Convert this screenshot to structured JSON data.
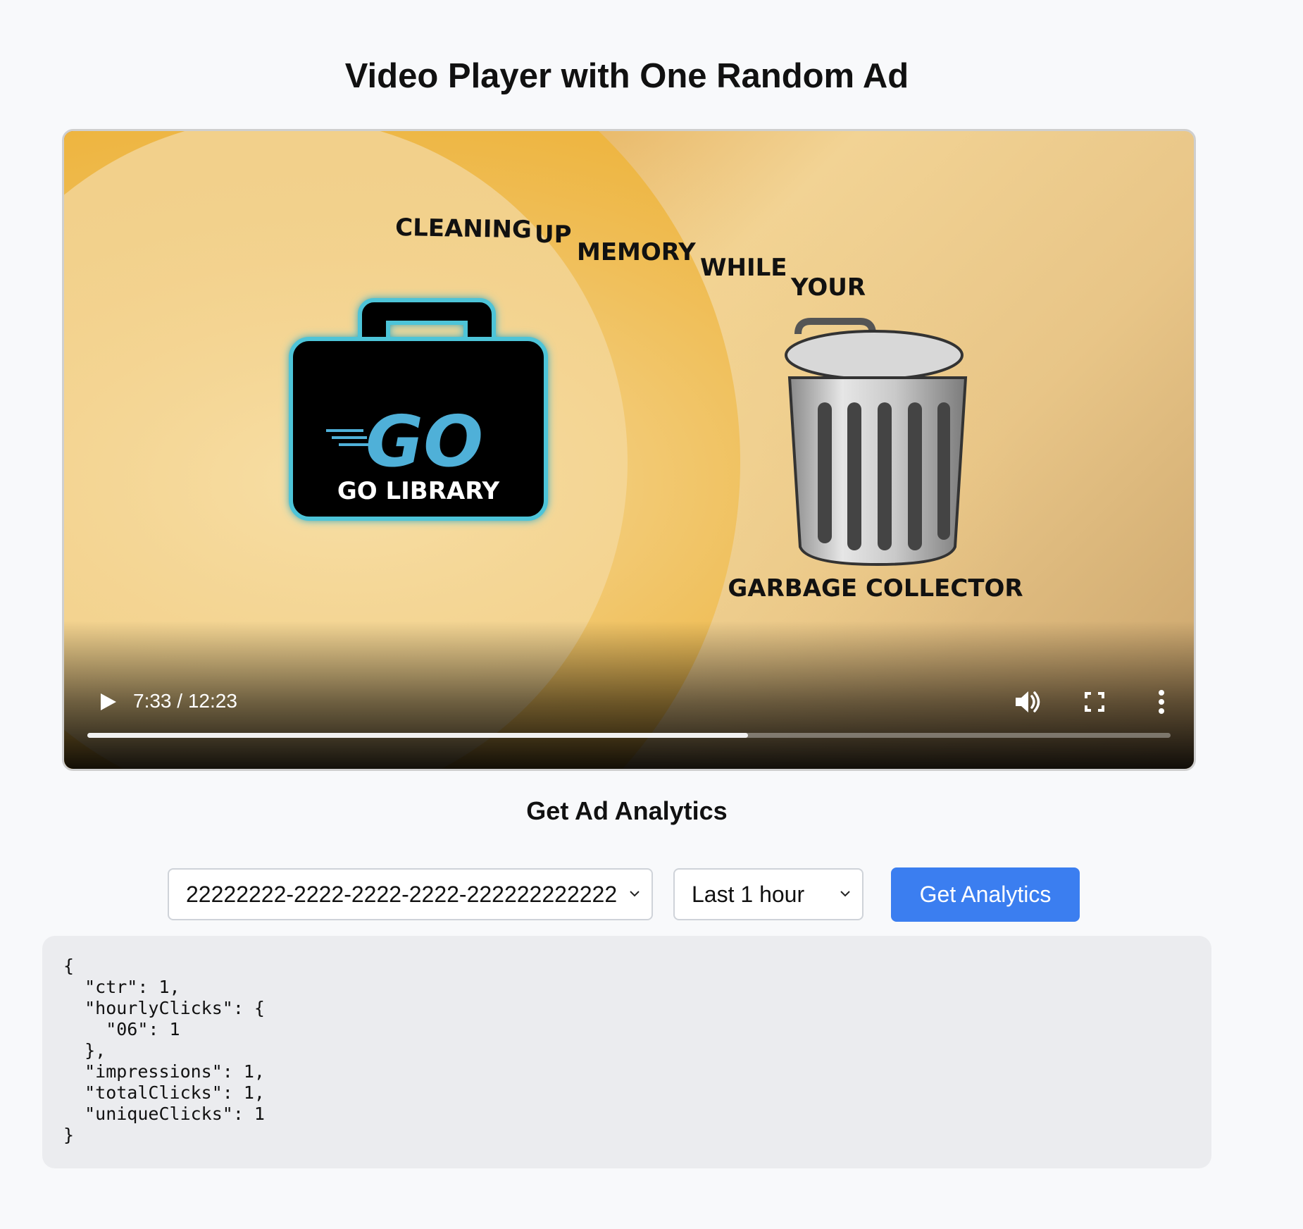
{
  "page": {
    "title": "Video Player with One Random Ad"
  },
  "video": {
    "scene_text": {
      "caption_words": [
        "CLEANING",
        "UP",
        "MEMORY",
        "WHILE",
        "YOUR"
      ],
      "bag_label": "GO LIBRARY",
      "bag_logo": "GO",
      "can_label": "GARBAGE COLLECTOR"
    },
    "controls": {
      "time": "7:33 / 12:23",
      "progress_fraction": 0.61,
      "play_icon": "play-icon",
      "volume_icon": "volume-icon",
      "fullscreen_icon": "fullscreen-icon",
      "more_icon": "more-vertical-icon"
    }
  },
  "analytics": {
    "heading": "Get Ad Analytics",
    "ad_select": {
      "selected": "22222222-2222-2222-2222-222222222222"
    },
    "range_select": {
      "selected": "Last 1 hour"
    },
    "button_label": "Get Analytics",
    "result": "{\n  \"ctr\": 1,\n  \"hourlyClicks\": {\n    \"06\": 1\n  },\n  \"impressions\": 1,\n  \"totalClicks\": 1,\n  \"uniqueClicks\": 1\n}"
  },
  "colors": {
    "accent": "#3b7ef0",
    "go_blue": "#4fb0d8",
    "page_bg": "#f8f9fb"
  }
}
